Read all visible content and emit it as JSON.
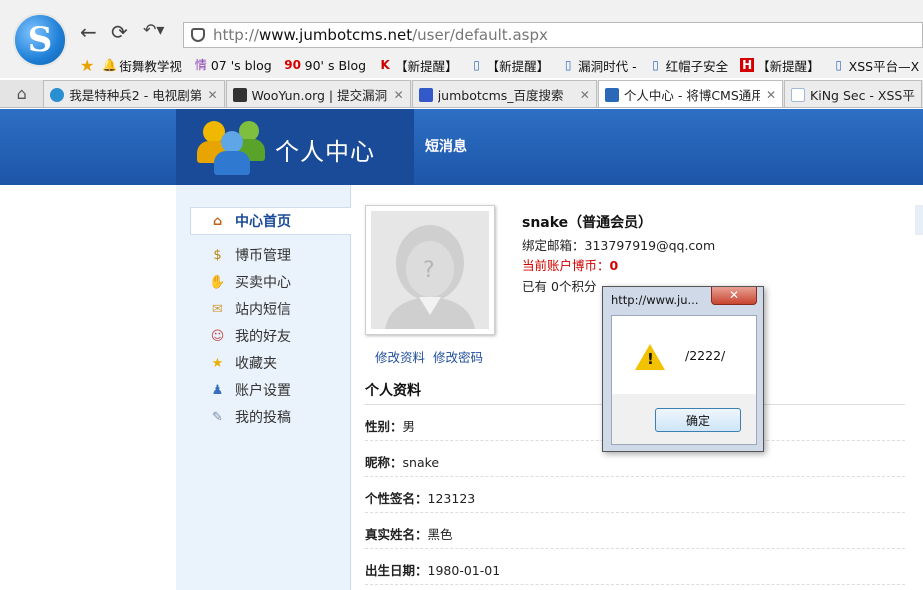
{
  "browser": {
    "url_scheme": "http://",
    "url_host": "www.jumbotcms.net",
    "url_path": "/user/default.aspx",
    "nav_back": "←",
    "nav_refresh": "⟳",
    "nav_undo": "↶▾"
  },
  "bookmarks": [
    {
      "label": "街舞教学视",
      "icon": "🔔"
    },
    {
      "label": "07 's blog",
      "icon": "情"
    },
    {
      "label": "90' s Blog",
      "icon": "90"
    },
    {
      "label": "【新提醒】",
      "icon": "K"
    },
    {
      "label": "【新提醒】",
      "icon": "▯"
    },
    {
      "label": "漏洞时代 -",
      "icon": "▯"
    },
    {
      "label": "红帽子安全",
      "icon": "▯"
    },
    {
      "label": "【新提醒】",
      "icon": "H"
    },
    {
      "label": "XSS平台—X",
      "icon": "▯"
    }
  ],
  "tabs": [
    {
      "label": "我是特种兵2 - 电视剧第",
      "color": "#2a8fd0",
      "active": false
    },
    {
      "label": "WooYun.org | 提交漏洞",
      "color": "#333333",
      "active": false
    },
    {
      "label": "jumbotcms_百度搜索",
      "color": "#3358c7",
      "active": false
    },
    {
      "label": "个人中心 - 将博CMS通用",
      "color": "#2c68b8",
      "active": true
    },
    {
      "label": "KiNg Sec - XSS平",
      "color": "#9fb9d9",
      "active": false
    }
  ],
  "header": {
    "title": "个人中心",
    "link": "短消息"
  },
  "sidebar": {
    "items": [
      {
        "label": "中心首页",
        "icon": "home-icon",
        "glyph": "⌂"
      },
      {
        "label": "博币管理",
        "icon": "coin-bag-icon",
        "glyph": "$"
      },
      {
        "label": "买卖中心",
        "icon": "handshake-icon",
        "glyph": "✋"
      },
      {
        "label": "站内短信",
        "icon": "envelope-icon",
        "glyph": "✉"
      },
      {
        "label": "我的好友",
        "icon": "friends-icon",
        "glyph": "☺"
      },
      {
        "label": "收藏夹",
        "icon": "star-icon",
        "glyph": "★"
      },
      {
        "label": "账户设置",
        "icon": "user-settings-icon",
        "glyph": "♟"
      },
      {
        "label": "我的投稿",
        "icon": "edit-icon",
        "glyph": "✎"
      }
    ]
  },
  "profile": {
    "name": "snake（普通会员）",
    "email_label": "绑定邮箱：",
    "email": "313797919@qq.com",
    "coins_label": "当前账户博币：",
    "coins": "0",
    "points_prefix": "已有 ",
    "points": "0",
    "points_suffix": "个积分",
    "edit_info": "修改资料",
    "edit_password": "修改密码"
  },
  "details": {
    "section_title": "个人资料",
    "rows": [
      {
        "key": "性别：",
        "value": "男"
      },
      {
        "key": "昵称：",
        "value": "snake"
      },
      {
        "key": "个性签名：",
        "value": "123123"
      },
      {
        "key": "真实姓名：",
        "value": "黑色"
      },
      {
        "key": "出生日期：",
        "value": "1980-01-01"
      }
    ]
  },
  "dialog": {
    "title": "http://www.ju...",
    "close": "✕",
    "message": "/2222/",
    "ok": "确定"
  },
  "colors": {
    "header_blue": "#1d55a8",
    "sidebar_bg": "#eaf2fb",
    "link_blue": "#1f4e9a",
    "alert_red": "#d40000"
  }
}
